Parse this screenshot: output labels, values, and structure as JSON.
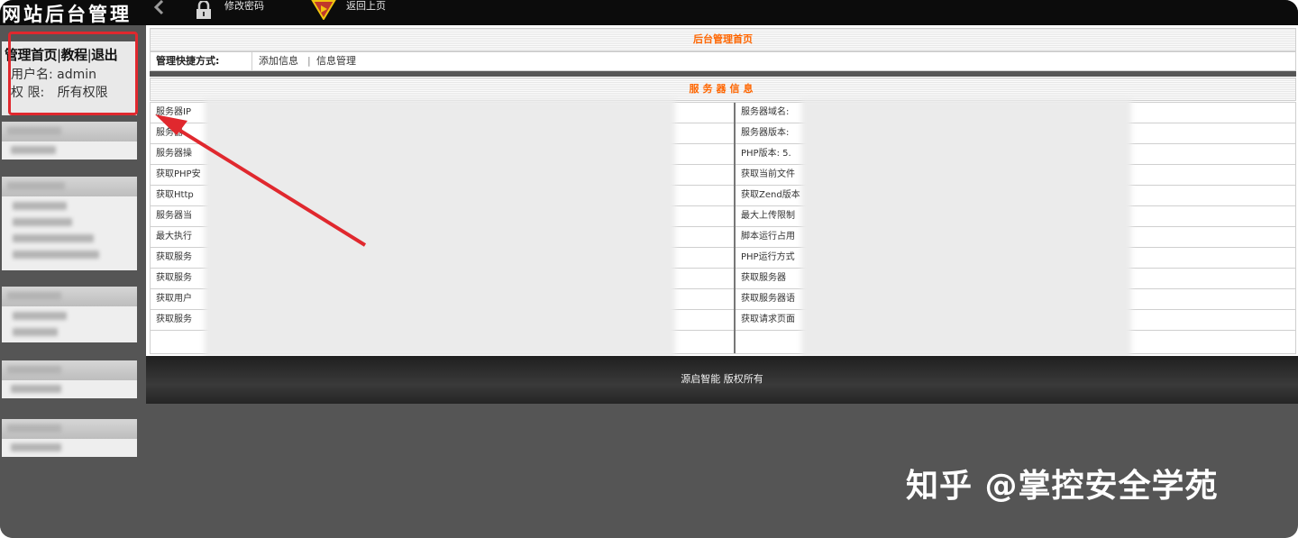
{
  "logo": "网站后台管理",
  "toolbar": {
    "change_password": "修改密码",
    "go_back": "返回上页"
  },
  "user_panel": {
    "links": [
      "管理首页",
      "教程",
      "退出"
    ],
    "username_label": "用户名:",
    "username": "admin",
    "permission_label": "权 限:",
    "permission": "所有权限"
  },
  "main": {
    "title": "后台管理首页",
    "shortcut_label": "管理快捷方式:",
    "shortcuts": [
      "添加信息",
      "信息管理"
    ],
    "shortcut_sep": "|",
    "server_title": "服务器信息",
    "left_rows": [
      "服务器IP",
      "服务器",
      "服务器操",
      "获取PHP安",
      "获取Http",
      "服务器当",
      "最大执行",
      "获取服务",
      "获取服务",
      "获取用户",
      "获取服务"
    ],
    "right_rows": [
      "服务器域名:",
      "服务器版本:",
      "PHP版本: 5.",
      "获取当前文件",
      "获取Zend版本",
      "最大上传限制",
      "脚本运行占用",
      "PHP运行方式",
      "获取服务器",
      "获取服务器语",
      "获取请求页面"
    ],
    "footer": "源启智能 版权所有"
  },
  "watermark": "知乎 @掌控安全学苑",
  "colors": {
    "accent_orange": "#ff6600",
    "annotation_red": "#e0282e",
    "page_bg": "#555555"
  }
}
